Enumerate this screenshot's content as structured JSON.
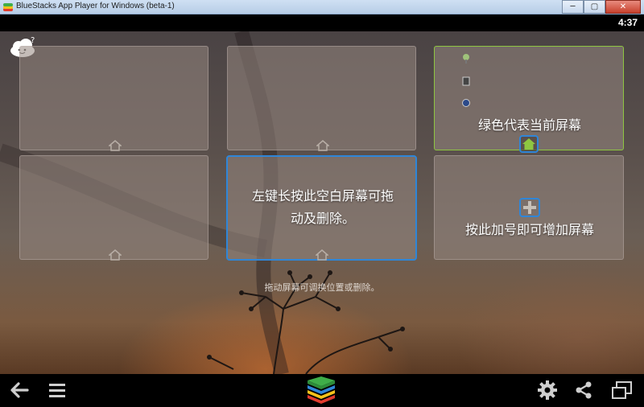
{
  "window": {
    "title": "BlueStacks App Player for Windows (beta-1)",
    "minimize": "─",
    "restore": "▢",
    "close": "✕"
  },
  "status": {
    "time": "4:37"
  },
  "cards": {
    "selected_text": "左键长按此空白屏幕可拖动及删除。",
    "current_text": "绿色代表当前屏幕",
    "add_text": "按此加号即可增加屏幕"
  },
  "hint": "拖动屏幕可调换位置或删除。",
  "icons": {
    "cloud": "cloud-help-icon",
    "home": "home-icon",
    "plus": "plus-icon",
    "back": "back-arrow-icon",
    "menu": "menu-icon",
    "logo": "bluestacks-logo-icon",
    "settings": "gear-icon",
    "share": "share-icon",
    "window": "window-mode-icon"
  },
  "colors": {
    "selected_border": "#2f86d8",
    "current_border": "#8ec641"
  }
}
